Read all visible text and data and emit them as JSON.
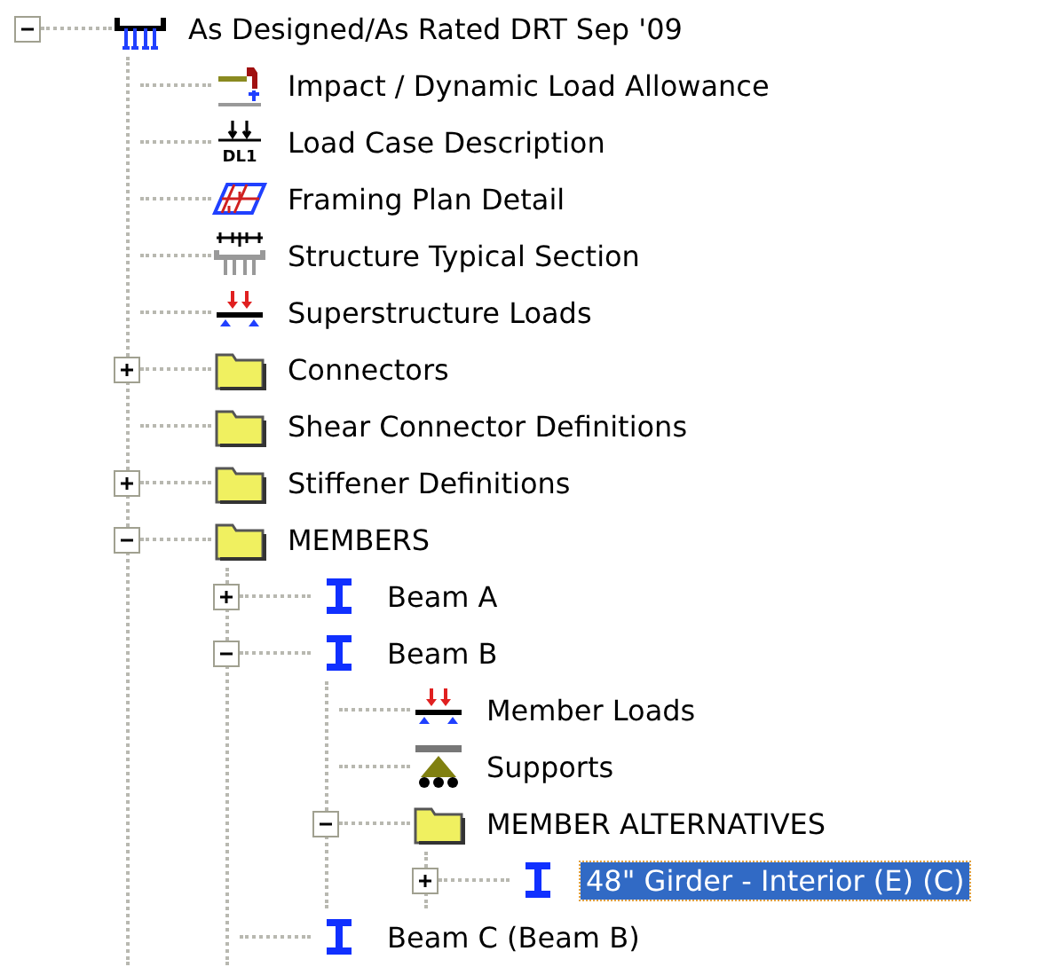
{
  "tree": [
    {
      "label": "As Designed/As Rated DRT Sep '09",
      "kind": "bridge",
      "expanded": true,
      "selected": false,
      "children": [
        {
          "label": "Impact / Dynamic Load Allowance",
          "kind": "impact",
          "selected": false
        },
        {
          "label": "Load Case Description",
          "kind": "load-case",
          "icon_label": "DL1",
          "selected": false
        },
        {
          "label": "Framing Plan Detail",
          "kind": "framing-plan",
          "selected": false
        },
        {
          "label": "Structure Typical Section",
          "kind": "section",
          "selected": false
        },
        {
          "label": "Superstructure Loads",
          "kind": "loads",
          "selected": false
        },
        {
          "label": "Connectors",
          "kind": "folder",
          "expanded": false,
          "selected": false
        },
        {
          "label": "Shear Connector Definitions",
          "kind": "folder",
          "selected": false
        },
        {
          "label": "Stiffener Definitions",
          "kind": "folder",
          "expanded": false,
          "selected": false
        },
        {
          "label": "MEMBERS",
          "kind": "folder",
          "expanded": true,
          "selected": false,
          "children": [
            {
              "label": "Beam A",
              "kind": "beam",
              "expanded": false,
              "selected": false
            },
            {
              "label": "Beam B",
              "kind": "beam",
              "expanded": true,
              "selected": false,
              "children": [
                {
                  "label": "Member Loads",
                  "kind": "loads",
                  "selected": false
                },
                {
                  "label": "Supports",
                  "kind": "supports",
                  "selected": false
                },
                {
                  "label": "MEMBER ALTERNATIVES",
                  "kind": "folder",
                  "expanded": true,
                  "selected": false,
                  "children": [
                    {
                      "label": "48\" Girder - Interior (E) (C)",
                      "kind": "beam",
                      "expanded": false,
                      "selected": true
                    }
                  ]
                }
              ]
            },
            {
              "label": "Beam C (Beam B)",
              "kind": "beam",
              "selected": false
            }
          ]
        }
      ]
    }
  ]
}
